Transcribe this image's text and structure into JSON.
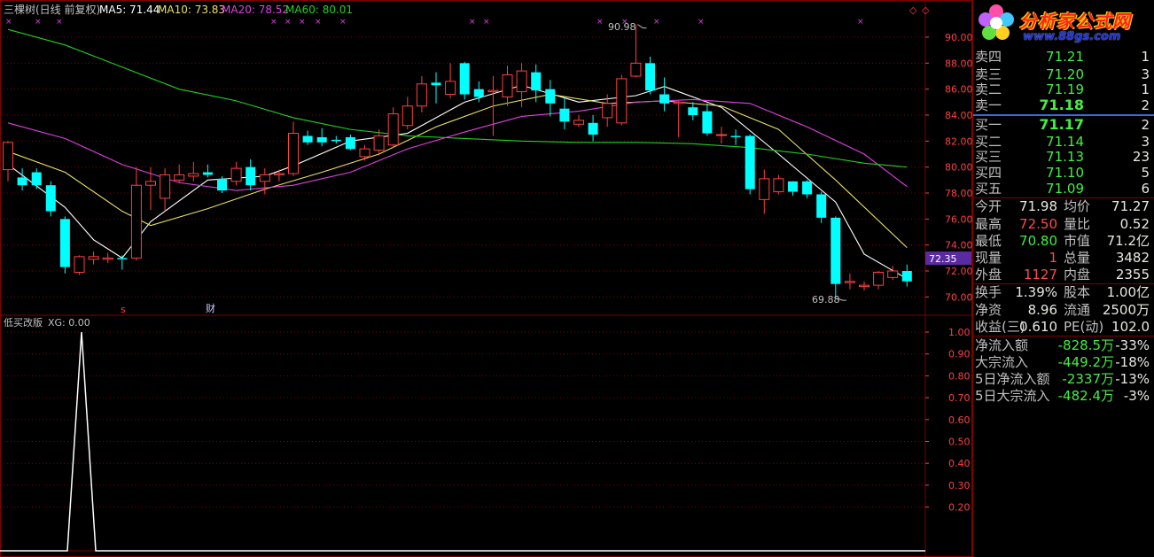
{
  "header": {
    "title": "三棵树(日线 前复权)",
    "ma5": "MA5: 71.44",
    "ma10": "MA10: 73.83",
    "ma20": "MA20: 78.52",
    "ma60": "MA60: 80.01"
  },
  "colors": {
    "up": "#ff4040",
    "down": "#00ffff",
    "ma5": "#ffffff",
    "ma10": "#e8e060",
    "ma20": "#e040e0",
    "ma60": "#20d020",
    "grid": "#800000",
    "axis": "#ff4040"
  },
  "price_axis": [
    "90.00",
    "88.00",
    "86.00",
    "84.00",
    "82.00",
    "80.00",
    "78.00",
    "76.00",
    "74.00",
    "72.00",
    "70.00"
  ],
  "markers": {
    "high": "90.98",
    "low": "69.88",
    "current": "72.35",
    "event_s": "s",
    "event_cai": "财"
  },
  "indicator": {
    "title": "低买改版",
    "xg": "XG: 0.00",
    "axis": [
      "1.00",
      "0.90",
      "0.80",
      "0.70",
      "0.60",
      "0.50",
      "0.40",
      "0.30",
      "0.20"
    ]
  },
  "chart_data": {
    "type": "candlestick",
    "ylim": [
      69.0,
      91.5
    ],
    "candles": [
      {
        "o": 79.8,
        "c": 81.9,
        "h": 82.0,
        "l": 78.9
      },
      {
        "o": 79.2,
        "c": 78.6,
        "h": 79.9,
        "l": 78.2
      },
      {
        "o": 79.6,
        "c": 78.6,
        "h": 79.9,
        "l": 78.3
      },
      {
        "o": 78.6,
        "c": 76.6,
        "h": 78.9,
        "l": 76.2
      },
      {
        "o": 76.0,
        "c": 72.3,
        "h": 76.2,
        "l": 71.8
      },
      {
        "o": 71.9,
        "c": 73.1,
        "h": 73.2,
        "l": 71.7
      },
      {
        "o": 72.9,
        "c": 73.1,
        "h": 73.5,
        "l": 72.5
      },
      {
        "o": 72.9,
        "c": 73.0,
        "h": 73.4,
        "l": 72.6
      },
      {
        "o": 73.0,
        "c": 72.9,
        "h": 73.2,
        "l": 72.1
      },
      {
        "o": 73.0,
        "c": 78.6,
        "h": 80.0,
        "l": 72.8
      },
      {
        "o": 78.6,
        "c": 78.9,
        "h": 80.0,
        "l": 76.7
      },
      {
        "o": 77.6,
        "c": 79.4,
        "h": 79.9,
        "l": 76.6
      },
      {
        "o": 79.0,
        "c": 79.4,
        "h": 80.2,
        "l": 78.8
      },
      {
        "o": 79.3,
        "c": 79.5,
        "h": 80.4,
        "l": 78.9
      },
      {
        "o": 79.6,
        "c": 79.4,
        "h": 80.2,
        "l": 79.2
      },
      {
        "o": 79.1,
        "c": 78.2,
        "h": 79.3,
        "l": 78.0
      },
      {
        "o": 78.9,
        "c": 79.9,
        "h": 80.4,
        "l": 78.6
      },
      {
        "o": 80.0,
        "c": 78.6,
        "h": 80.6,
        "l": 78.2
      },
      {
        "o": 78.9,
        "c": 79.4,
        "h": 79.9,
        "l": 77.9
      },
      {
        "o": 79.4,
        "c": 79.5,
        "h": 79.8,
        "l": 78.9
      },
      {
        "o": 79.5,
        "c": 82.6,
        "h": 83.5,
        "l": 79.3
      },
      {
        "o": 82.4,
        "c": 81.9,
        "h": 82.8,
        "l": 81.7
      },
      {
        "o": 82.3,
        "c": 81.9,
        "h": 83.0,
        "l": 81.6
      },
      {
        "o": 82.1,
        "c": 82.0,
        "h": 82.4,
        "l": 81.8
      },
      {
        "o": 82.3,
        "c": 81.4,
        "h": 82.5,
        "l": 81.3
      },
      {
        "o": 80.8,
        "c": 81.4,
        "h": 81.7,
        "l": 80.5
      },
      {
        "o": 81.3,
        "c": 82.4,
        "h": 82.9,
        "l": 80.9
      },
      {
        "o": 81.7,
        "c": 84.1,
        "h": 84.6,
        "l": 81.5
      },
      {
        "o": 83.2,
        "c": 84.7,
        "h": 85.4,
        "l": 82.9
      },
      {
        "o": 84.7,
        "c": 86.4,
        "h": 87.0,
        "l": 84.2
      },
      {
        "o": 86.5,
        "c": 86.3,
        "h": 87.3,
        "l": 84.9
      },
      {
        "o": 85.6,
        "c": 86.6,
        "h": 88.0,
        "l": 85.3
      },
      {
        "o": 88.0,
        "c": 85.6,
        "h": 88.1,
        "l": 85.2
      },
      {
        "o": 86.0,
        "c": 85.4,
        "h": 86.6,
        "l": 85.0
      },
      {
        "o": 85.8,
        "c": 85.9,
        "h": 87.0,
        "l": 82.4
      },
      {
        "o": 85.4,
        "c": 87.1,
        "h": 87.8,
        "l": 84.7
      },
      {
        "o": 85.8,
        "c": 87.4,
        "h": 88.0,
        "l": 84.6
      },
      {
        "o": 87.3,
        "c": 85.9,
        "h": 87.9,
        "l": 85.0
      },
      {
        "o": 86.0,
        "c": 84.9,
        "h": 86.7,
        "l": 83.9
      },
      {
        "o": 84.5,
        "c": 83.5,
        "h": 85.4,
        "l": 82.9
      },
      {
        "o": 83.3,
        "c": 83.6,
        "h": 84.0,
        "l": 83.1
      },
      {
        "o": 83.4,
        "c": 82.5,
        "h": 84.0,
        "l": 82.0
      },
      {
        "o": 83.8,
        "c": 84.9,
        "h": 85.6,
        "l": 83.1
      },
      {
        "o": 83.4,
        "c": 86.8,
        "h": 87.1,
        "l": 83.2
      },
      {
        "o": 87.0,
        "c": 88.0,
        "h": 90.98,
        "l": 86.9
      },
      {
        "o": 88.0,
        "c": 85.9,
        "h": 88.5,
        "l": 85.6
      },
      {
        "o": 85.6,
        "c": 84.9,
        "h": 86.9,
        "l": 84.3
      },
      {
        "o": 84.9,
        "c": 85.0,
        "h": 85.1,
        "l": 82.3
      },
      {
        "o": 84.6,
        "c": 84.0,
        "h": 85.0,
        "l": 83.6
      },
      {
        "o": 84.3,
        "c": 82.6,
        "h": 84.9,
        "l": 82.4
      },
      {
        "o": 82.5,
        "c": 82.5,
        "h": 83.1,
        "l": 81.8
      },
      {
        "o": 82.4,
        "c": 82.3,
        "h": 82.9,
        "l": 81.7
      },
      {
        "o": 82.4,
        "c": 78.3,
        "h": 82.5,
        "l": 77.9
      },
      {
        "o": 77.5,
        "c": 79.1,
        "h": 79.8,
        "l": 76.4
      },
      {
        "o": 78.1,
        "c": 79.1,
        "h": 79.4,
        "l": 77.9
      },
      {
        "o": 78.9,
        "c": 78.1,
        "h": 78.9,
        "l": 77.8
      },
      {
        "o": 78.9,
        "c": 77.9,
        "h": 79.0,
        "l": 77.6
      },
      {
        "o": 77.9,
        "c": 76.1,
        "h": 78.1,
        "l": 75.7
      },
      {
        "o": 76.1,
        "c": 71.0,
        "h": 76.2,
        "l": 69.88
      },
      {
        "o": 71.1,
        "c": 71.2,
        "h": 71.8,
        "l": 70.6
      },
      {
        "o": 70.8,
        "c": 70.9,
        "h": 71.2,
        "l": 70.5
      },
      {
        "o": 70.9,
        "c": 71.9,
        "h": 72.0,
        "l": 70.6
      },
      {
        "o": 71.5,
        "c": 72.0,
        "h": 72.4,
        "l": 71.3
      },
      {
        "o": 72.0,
        "c": 71.2,
        "h": 72.5,
        "l": 70.8
      }
    ],
    "ma_lines": [
      {
        "name": "MA5",
        "values": [
          [
            0,
            80.2
          ],
          [
            4,
            76.9
          ],
          [
            6,
            74.4
          ],
          [
            8,
            73.0
          ],
          [
            10,
            75.8
          ],
          [
            14,
            79.0
          ],
          [
            18,
            79.3
          ],
          [
            20,
            80.1
          ],
          [
            24,
            82.0
          ],
          [
            28,
            82.6
          ],
          [
            32,
            85.0
          ],
          [
            36,
            86.3
          ],
          [
            40,
            85.0
          ],
          [
            44,
            85.5
          ],
          [
            46,
            86.2
          ],
          [
            50,
            84.6
          ],
          [
            54,
            81.0
          ],
          [
            58,
            77.3
          ],
          [
            60,
            73.3
          ],
          [
            63,
            71.4
          ]
        ]
      },
      {
        "name": "MA10",
        "values": [
          [
            0,
            81.2
          ],
          [
            4,
            79.6
          ],
          [
            8,
            76.6
          ],
          [
            10,
            75.5
          ],
          [
            14,
            76.8
          ],
          [
            18,
            78.3
          ],
          [
            22,
            79.6
          ],
          [
            26,
            81.0
          ],
          [
            30,
            83.1
          ],
          [
            34,
            84.7
          ],
          [
            38,
            85.6
          ],
          [
            42,
            84.9
          ],
          [
            46,
            85.1
          ],
          [
            50,
            84.7
          ],
          [
            54,
            82.9
          ],
          [
            58,
            79.0
          ],
          [
            63,
            73.8
          ]
        ]
      },
      {
        "name": "MA20",
        "values": [
          [
            0,
            83.4
          ],
          [
            4,
            82.2
          ],
          [
            8,
            80.2
          ],
          [
            12,
            78.8
          ],
          [
            16,
            78.2
          ],
          [
            20,
            78.6
          ],
          [
            24,
            79.6
          ],
          [
            28,
            81.4
          ],
          [
            32,
            82.7
          ],
          [
            36,
            83.9
          ],
          [
            40,
            84.3
          ],
          [
            44,
            85.0
          ],
          [
            48,
            85.2
          ],
          [
            52,
            84.9
          ],
          [
            56,
            83.1
          ],
          [
            60,
            81.0
          ],
          [
            63,
            78.5
          ]
        ]
      },
      {
        "name": "MA60",
        "values": [
          [
            0,
            90.6
          ],
          [
            4,
            89.4
          ],
          [
            8,
            87.7
          ],
          [
            12,
            86.0
          ],
          [
            16,
            85.1
          ],
          [
            20,
            83.8
          ],
          [
            24,
            82.9
          ],
          [
            28,
            82.4
          ],
          [
            32,
            82.2
          ],
          [
            36,
            82.0
          ],
          [
            40,
            81.9
          ],
          [
            44,
            81.9
          ],
          [
            48,
            81.8
          ],
          [
            52,
            81.5
          ],
          [
            56,
            81.0
          ],
          [
            60,
            80.3
          ],
          [
            63,
            80.0
          ]
        ]
      }
    ],
    "xg_signal": {
      "index": 5,
      "value": 1.0
    }
  },
  "panel": {
    "logo_title": "分析家公式网",
    "logo_url": "www.88gs.com",
    "asks": [
      {
        "label": "卖四",
        "price": "71.21",
        "vol": "1"
      },
      {
        "label": "卖三",
        "price": "71.20",
        "vol": "3"
      },
      {
        "label": "卖二",
        "price": "71.19",
        "vol": "1"
      },
      {
        "label": "卖一",
        "price": "71.18",
        "vol": "2"
      }
    ],
    "bids": [
      {
        "label": "买一",
        "price": "71.17",
        "vol": "2"
      },
      {
        "label": "买二",
        "price": "71.14",
        "vol": "3"
      },
      {
        "label": "买三",
        "price": "71.13",
        "vol": "23"
      },
      {
        "label": "买四",
        "price": "71.10",
        "vol": "5"
      },
      {
        "label": "买五",
        "price": "71.09",
        "vol": "6"
      }
    ],
    "stats": [
      {
        "l1": "今开",
        "v1": "71.98",
        "c1": "white",
        "l2": "均价",
        "v2": "71.27",
        "c2": "green"
      },
      {
        "l1": "最高",
        "v1": "72.50",
        "c1": "red",
        "l2": "量比",
        "v2": "0.52",
        "c2": "green"
      },
      {
        "l1": "最低",
        "v1": "70.80",
        "c1": "green",
        "l2": "市值",
        "v2": "71.2亿",
        "c2": "white"
      },
      {
        "l1": "现量",
        "v1": "1",
        "c1": "red",
        "l2": "总量",
        "v2": "3482",
        "c2": "white"
      },
      {
        "l1": "外盘",
        "v1": "1127",
        "c1": "red",
        "l2": "内盘",
        "v2": "2355",
        "c2": "green"
      }
    ],
    "stats2": [
      {
        "l1": "换手",
        "v1": "1.39%",
        "l2": "股本",
        "v2": "1.00亿"
      },
      {
        "l1": "净资",
        "v1": "8.96",
        "l2": "流通",
        "v2": "2500万"
      },
      {
        "l1": "收益(三)",
        "v1": "0.610",
        "l2": "PE(动)",
        "v2": "102.0"
      }
    ],
    "flows": [
      {
        "label": "净流入额",
        "v1": "-828.5万",
        "v2": "-33%"
      },
      {
        "label": "大宗流入",
        "v1": "-449.2万",
        "v2": "-18%"
      },
      {
        "label": "5日净流入额",
        "v1": "-2337万",
        "v2": "-13%"
      },
      {
        "label": "5日大宗流入",
        "v1": "-482.4万",
        "v2": "-3%"
      }
    ]
  }
}
